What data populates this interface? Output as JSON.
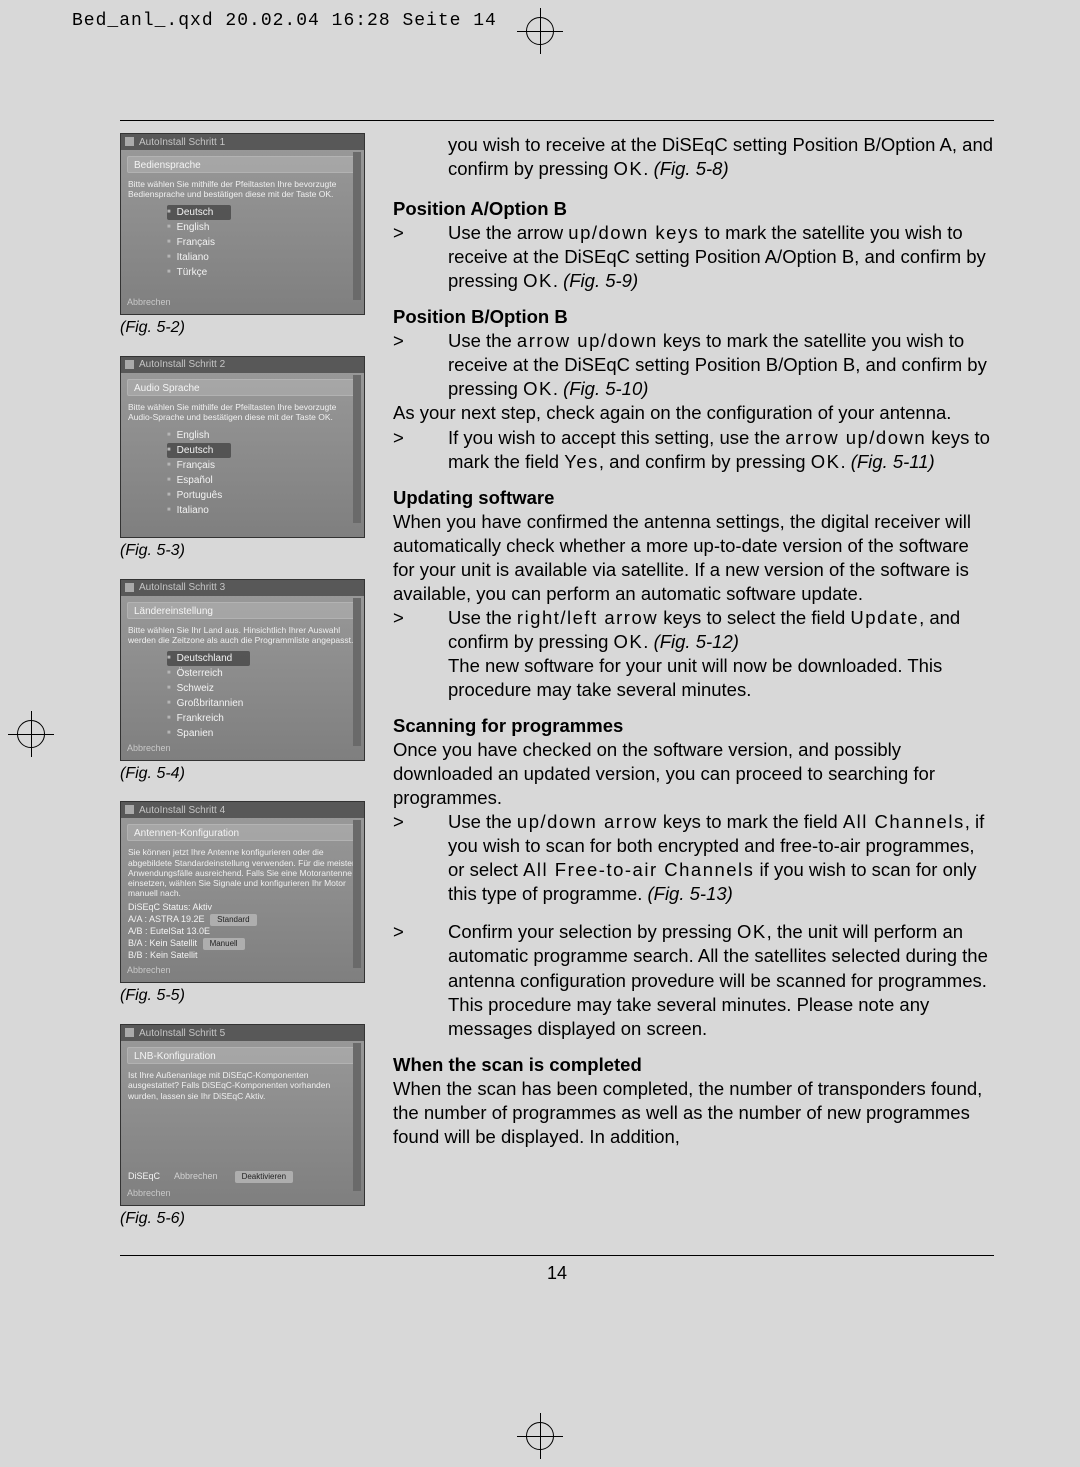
{
  "print_header": "Bed_anl_.qxd  20.02.04  16:28  Seite 14",
  "page_number": "14",
  "figures": [
    {
      "caption": "(Fig. 5-2)",
      "titlebar": "AutoInstall  Schritt 1",
      "header": "Bediensprache",
      "hint": "Bitte wählen Sie mithilfe der Pfeiltasten Ihre bevorzugte Bediensprache und bestätigen diese mit der Taste OK.",
      "items": [
        "Deutsch",
        "English",
        "Français",
        "Italiano",
        "Türkçe"
      ],
      "hl": 0,
      "footer": "Abbrechen"
    },
    {
      "caption": "(Fig. 5-3)",
      "titlebar": "AutoInstall  Schritt 2",
      "header": "Audio Sprache",
      "hint": "Bitte wählen Sie mithilfe der Pfeiltasten Ihre bevorzugte Audio-Sprache und bestätigen diese mit der Taste OK.",
      "items": [
        "English",
        "Deutsch",
        "Français",
        "Español",
        "Português",
        "Italiano"
      ],
      "hl": 1,
      "footer": ""
    },
    {
      "caption": "(Fig. 5-4)",
      "titlebar": "AutoInstall  Schritt 3",
      "header": "Ländereinstellung",
      "hint": "Bitte wählen Sie Ihr Land aus. Hinsichtlich Ihrer Auswahl werden die Zeitzone als auch die Programmliste angepasst.",
      "items": [
        "Deutschland",
        "Österreich",
        "Schweiz",
        "Großbritannien",
        "Frankreich",
        "Spanien"
      ],
      "hl": 0,
      "footer": "Abbrechen"
    },
    {
      "caption": "(Fig. 5-5)",
      "titlebar": "AutoInstall  Schritt 4",
      "header": "Antennen-Konfiguration",
      "hint": "Sie können jetzt Ihre Antenne konfigurieren oder die abgebildete Standardeinstellung verwenden. Für die meisten Anwendungsfälle ausreichend. Falls Sie eine Motorantenne einsetzen, wählen Sie Signale und konfigurieren Ihr Motor manuell nach.",
      "table": [
        "DiSEqC Status: Aktiv",
        "A/A : ASTRA       19.2E",
        "A/B : EutelSat      13.0E",
        "B/A : Kein Satellit",
        "B/B : Kein Satellit"
      ],
      "buttons": [
        "Standard",
        "Manuell"
      ],
      "footer": "Abbrechen"
    },
    {
      "caption": "(Fig. 5-6)",
      "titlebar": "AutoInstall  Schritt 5",
      "header": "LNB-Konfiguration",
      "hint": "Ist Ihre Außenanlage mit DiSEqC-Komponenten ausgestattet? Falls DiSEqC-Komponenten vorhanden wurden, lassen sie Ihr DiSEqC Aktiv.",
      "bottom_row": [
        "DiSEqC",
        "Abbrechen",
        "Deaktivieren"
      ],
      "footer": "Abbrechen"
    }
  ],
  "body": {
    "intro1": "you wish to receive at the DiSEqC setting Position B/Option A, and confirm by pressing ",
    "intro1_key": "OK",
    "intro1_fig": "(Fig. 5-8)",
    "posAB_h": "Position A/Option B",
    "posAB_l1a": "Use the arrow ",
    "posAB_l1_key": "up/down keys",
    "posAB_l1b": " to mark the satellite you wish to receive at the DiSEqC setting Position A/Option B, and confirm by pressing ",
    "posAB_ok": "OK",
    "posAB_fig": "(Fig. 5-9)",
    "posBB_h": "Position B/Option B",
    "posBB_l1a": "Use the ",
    "posBB_l1_key": "arrow up/down",
    "posBB_l1b": " keys to mark the satellite you wish to receive at the DiSEqC setting Position B/Option B, and confirm by pressing ",
    "posBB_ok": "OK",
    "posBB_fig": "(Fig. 5-10)",
    "posBB_after": "As your next step, check again on the configuration of your antenna.",
    "posBB_l2a": "If you wish to accept this setting, use the ",
    "posBB_l2_key": "arrow up/down",
    "posBB_l2b": " keys to mark the field ",
    "posBB_yes": "Yes",
    "posBB_l2c": ", and confirm by pressing ",
    "posBB_ok2": "OK",
    "posBB_fig2": "(Fig. 5-11)",
    "upd_h": "Updating software",
    "upd_p": "When you have confirmed the antenna settings, the digital receiver will automatically check whether a more up-to-date version of the software for your unit is available via satellite. If a new version of the software is available, you can perform an automatic software update.",
    "upd_l1a": "Use the ",
    "upd_l1_key": "right/left arrow",
    "upd_l1b": " keys to select the field ",
    "upd_update": "Update",
    "upd_l1c": ", and confirm by pressing ",
    "upd_ok": "OK",
    "upd_fig": "(Fig. 5-12)",
    "upd_after": "The new software for your unit will now be downloaded. This procedure may take several minutes.",
    "scan_h": "Scanning for programmes",
    "scan_p": "Once you have checked on the software version, and possibly downloaded an updated version, you can proceed to searching for programmes.",
    "scan_l1a": "Use the ",
    "scan_l1_key": "up/down arrow",
    "scan_l1b": " keys to mark the field ",
    "scan_all": "All Channels",
    "scan_l1c": ", if you wish to scan for both encrypted and free-to-air programmes, or select ",
    "scan_fta": "All Free-to-air Channels",
    "scan_l1d": " if you wish to scan for only this type of programme. ",
    "scan_fig": "(Fig. 5-13)",
    "scan_l2a": "Confirm your selection by pressing ",
    "scan_ok": "OK",
    "scan_l2b": ", the unit will perform an automatic programme search. All the satellites selected during the antenna configuration provedure will be scanned for programmes. This procedure may take several minutes. Please note any messages displayed on screen.",
    "done_h": "When the scan is completed",
    "done_p": "When the scan has been completed, the number of transponders found, the number of programmes as well as the number of new programmes found will be displayed. In addition,"
  }
}
